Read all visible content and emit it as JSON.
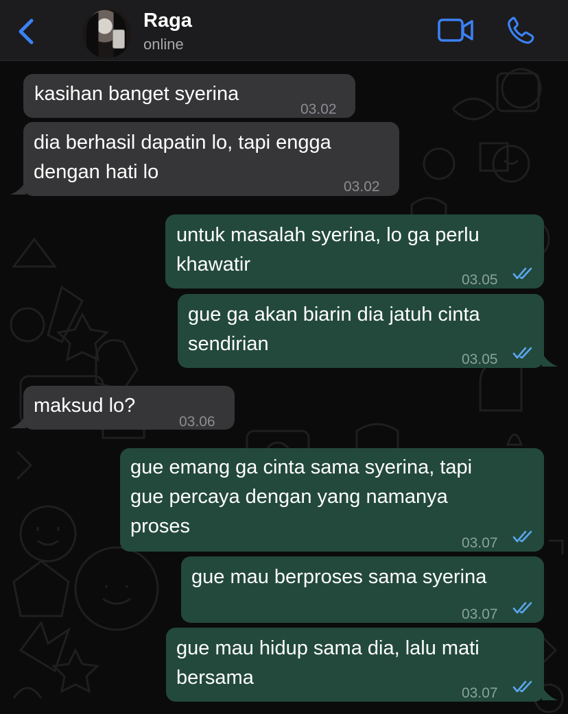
{
  "header": {
    "back_label": "Back",
    "contact_name": "Raga",
    "contact_status": "online",
    "icons": [
      "chevron-left-icon",
      "video-call-icon",
      "phone-icon"
    ]
  },
  "colors": {
    "accent": "#3b82f6",
    "incoming_bubble": "#363638",
    "outgoing_bubble": "#23493c",
    "read_ticks": "#5aa7f0"
  },
  "messages": [
    {
      "direction": "incoming",
      "text": "kasihan banget syerina",
      "time": "03.02"
    },
    {
      "direction": "incoming",
      "text": "dia berhasil dapatin lo, tapi engga\ndengan hati lo",
      "time": "03.02"
    },
    {
      "direction": "outgoing",
      "text": "untuk masalah syerina, lo ga perlu\nkhawatir",
      "time": "03.05",
      "read": true
    },
    {
      "direction": "outgoing",
      "text": "gue ga akan biarin dia jatuh cinta\nsendirian",
      "time": "03.05",
      "read": true
    },
    {
      "direction": "incoming",
      "text": "maksud lo?",
      "time": "03.06"
    },
    {
      "direction": "outgoing",
      "text": "gue emang ga cinta sama syerina, tapi\ngue percaya dengan yang namanya\nproses",
      "time": "03.07",
      "read": true
    },
    {
      "direction": "outgoing",
      "text": "gue mau berproses sama syerina",
      "time": "03.07",
      "read": true
    },
    {
      "direction": "outgoing",
      "text": "gue mau hidup sama dia, lalu mati\nbersama",
      "time": "03.07",
      "read": true
    }
  ]
}
